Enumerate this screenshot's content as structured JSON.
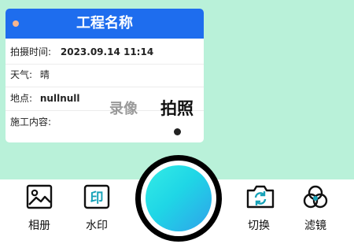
{
  "card": {
    "title": "工程名称",
    "rows": [
      {
        "label": "拍摄时间:",
        "value": "2023.09.14  11:14"
      },
      {
        "label": "天气:",
        "value": "晴"
      },
      {
        "label": "地点:",
        "value": "nullnull"
      },
      {
        "label": "施工内容:",
        "value": ""
      }
    ]
  },
  "modes": {
    "video": "录像",
    "photo": "拍照",
    "active": "photo"
  },
  "toolbar": {
    "album": "相册",
    "watermark": "水印",
    "switch": "切换",
    "filter": "滤镜"
  },
  "icons": {
    "album": "image-icon",
    "watermark": "stamp-icon",
    "switch": "camera-switch-icon",
    "filter": "filter-circles-icon"
  },
  "colors": {
    "background": "#b9f1d9",
    "header": "#1e6dee",
    "shutter": "#2fd8e6"
  }
}
